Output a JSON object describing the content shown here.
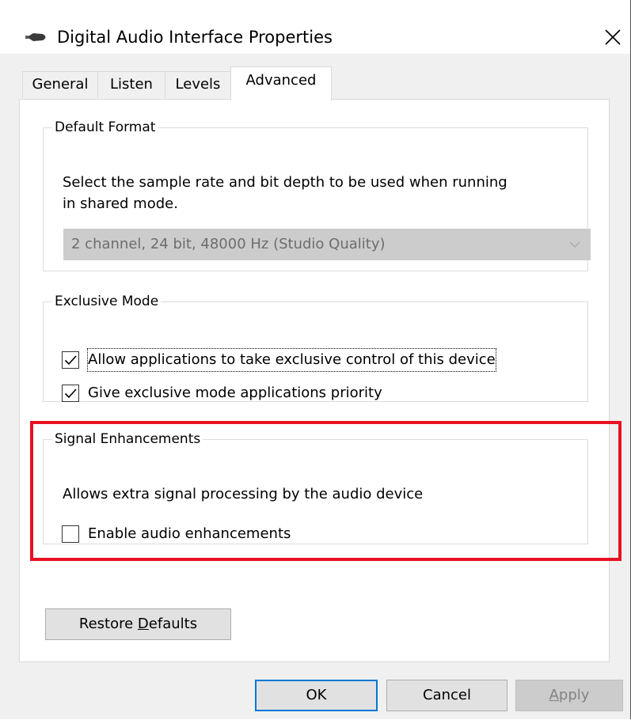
{
  "window": {
    "title": "Digital Audio Interface Properties",
    "title_icon": "speaker-icon",
    "close_icon": "close-icon"
  },
  "tabs": [
    {
      "label": "General",
      "active": false
    },
    {
      "label": "Listen",
      "active": false
    },
    {
      "label": "Levels",
      "active": false
    },
    {
      "label": "Advanced",
      "active": true
    }
  ],
  "default_format": {
    "legend": "Default Format",
    "desc_line1": "Select the sample rate and bit depth to be used when running",
    "desc_line2": "in shared mode.",
    "selected": "2 channel, 24 bit, 48000 Hz (Studio Quality)",
    "disabled": true
  },
  "exclusive_mode": {
    "legend": "Exclusive Mode",
    "options": [
      {
        "label": "Allow applications to take exclusive control of this device",
        "checked": true
      },
      {
        "label": "Give exclusive mode applications priority",
        "checked": true
      }
    ]
  },
  "signal_enhancements": {
    "legend": "Signal Enhancements",
    "desc": "Allows extra signal processing by the audio device",
    "option": {
      "label": "Enable audio enhancements",
      "checked": false
    }
  },
  "restore_defaults": {
    "pre": "Restore ",
    "mnemonic": "D",
    "post": "efaults"
  },
  "buttons": {
    "ok": "OK",
    "cancel": "Cancel",
    "apply_mnemonic": "A",
    "apply_rest": "pply"
  },
  "colors": {
    "highlight": "#e81123",
    "accent": "#0078d7",
    "disabled_bg": "#cccccc"
  }
}
